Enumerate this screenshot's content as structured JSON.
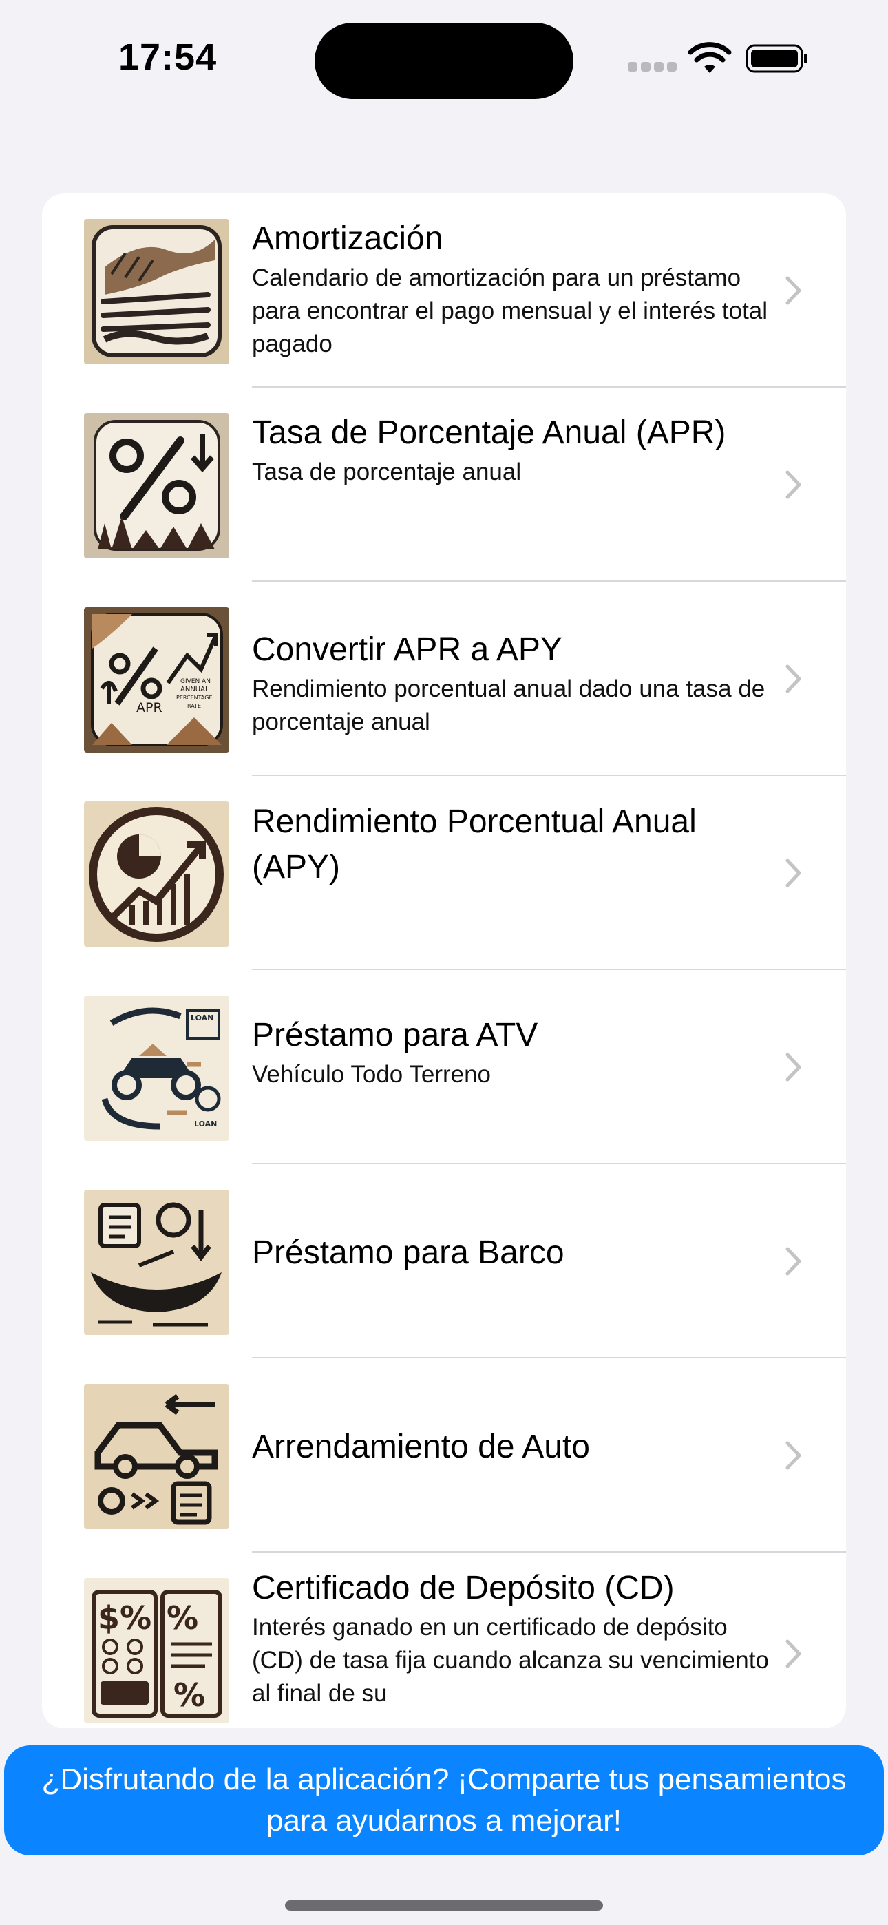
{
  "status_bar": {
    "time": "17:54"
  },
  "colors": {
    "accent": "#0A84FF",
    "background": "#F2F2F7",
    "chevron": "#C4C4C7"
  },
  "list": {
    "items": [
      {
        "title": "Amortización",
        "subtitle": "Calendario de amortización para un préstamo para encontrar el pago mensual y el interés total pagado",
        "icon": "amortization-icon"
      },
      {
        "title": "Tasa de Porcentaje Anual (APR)",
        "subtitle": "Tasa de porcentaje anual",
        "icon": "apr-percent-icon"
      },
      {
        "title": "Convertir APR a APY",
        "subtitle": "Rendimiento porcentual anual dado una tasa de porcentaje anual",
        "icon": "apr-to-apy-icon",
        "icon_text": "GIVEN AN ANNUAL PERCENTAGE RATE APR"
      },
      {
        "title": "Rendimiento Porcentual Anual (APY)",
        "subtitle": "",
        "icon": "apy-growth-icon"
      },
      {
        "title": "Préstamo para ATV",
        "subtitle": "Vehículo Todo Terreno",
        "icon": "atv-loan-icon",
        "icon_text": "LOAN"
      },
      {
        "title": "Préstamo para Barco",
        "subtitle": "",
        "icon": "boat-loan-icon"
      },
      {
        "title": "Arrendamiento de Auto",
        "subtitle": "",
        "icon": "car-lease-icon"
      },
      {
        "title": "Certificado de Depósito (CD)",
        "subtitle": "Interés ganado en un certificado de depósito (CD) de tasa fija cuando alcanza su vencimiento al final de su",
        "icon": "certificate-deposit-icon"
      }
    ]
  },
  "feedback_banner": {
    "label": "¿Disfrutando de la aplicación? ¡Comparte tus pensamientos para ayudarnos a mejorar!"
  }
}
